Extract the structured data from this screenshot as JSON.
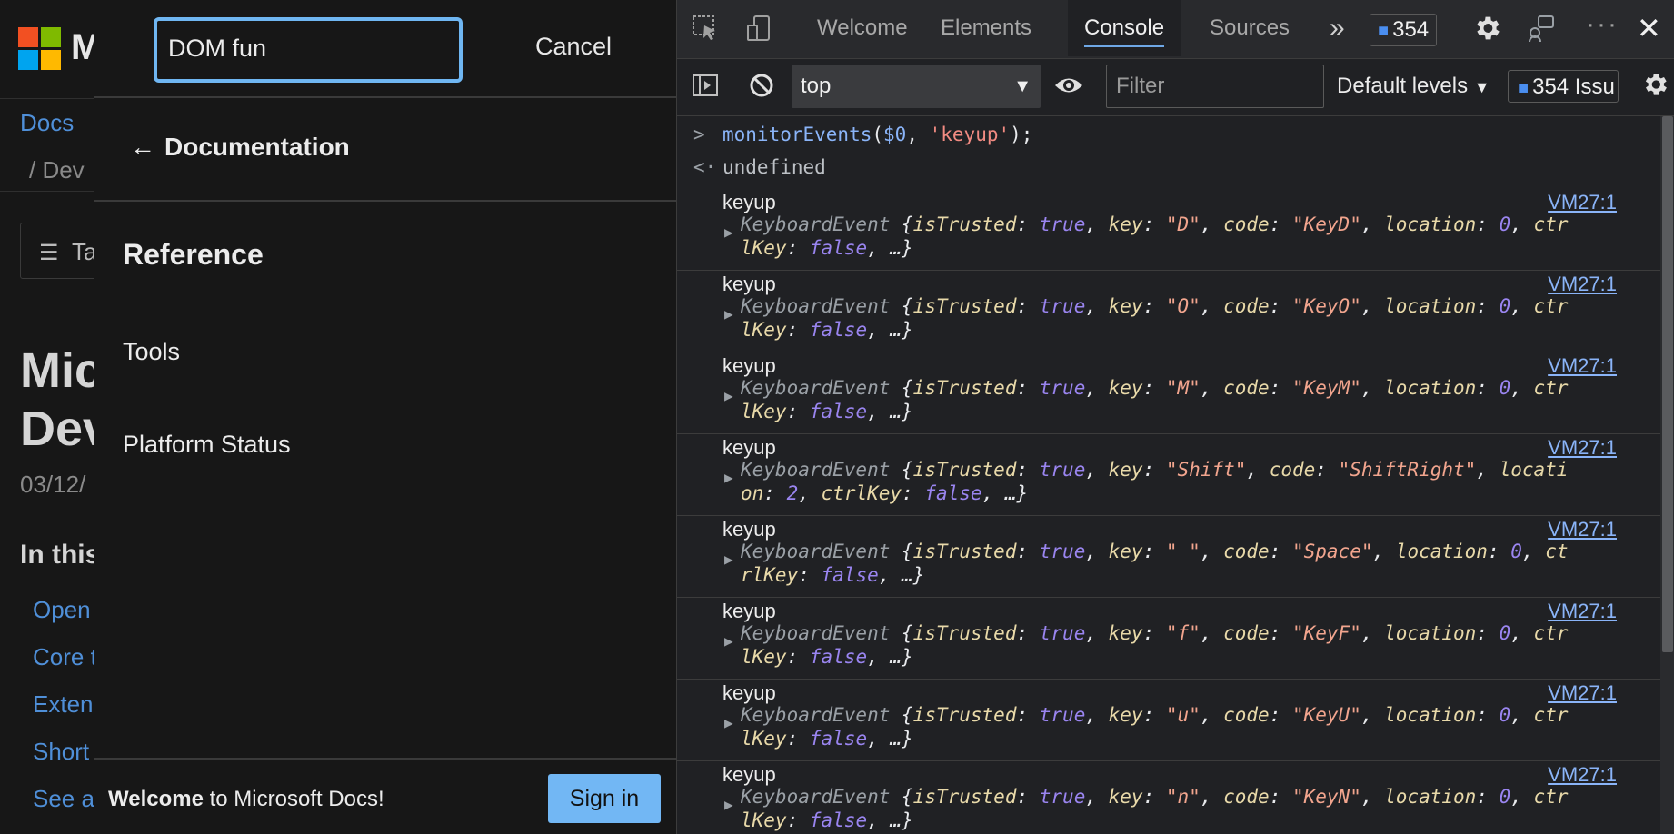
{
  "bg": {
    "logo_text": "M",
    "crumb": "Docs",
    "crumb2": "/  Dev",
    "toc_label": "Ta",
    "title_line1": "Mic",
    "title_line2": "Dev",
    "date": "03/12/",
    "in_this": "In this",
    "links": [
      "Open",
      "Core t",
      "Exten",
      "Short",
      "See a"
    ]
  },
  "overlay": {
    "search_value": "DOM fun",
    "cancel_label": "Cancel",
    "back_label": "Documentation",
    "section_heading": "Reference",
    "nav_items": [
      "Tools",
      "Platform Status"
    ],
    "welcome_bold": "Welcome",
    "welcome_rest": " to Microsoft Docs!",
    "signin_label": "Sign in"
  },
  "devtools": {
    "tabs": [
      "Welcome",
      "Elements",
      "Console",
      "Sources"
    ],
    "active_tab": "Console",
    "more_tabs": "»",
    "issues_badge": "354",
    "context": "top",
    "filter_placeholder": "Filter",
    "levels_label": "Default levels",
    "issues_label": "354 Issu",
    "icons": [
      "inspect-icon",
      "device-icon",
      "settings-icon",
      "feedback-icon",
      "more-icon",
      "close-icon",
      "sidebar-toggle-icon",
      "clear-console-icon",
      "eye-icon",
      "console-settings-icon"
    ]
  },
  "console": {
    "command_fn": "monitorEvents",
    "command_arg": "$0",
    "command_str": "'keyup'",
    "result": "undefined",
    "source": "VM27:1",
    "event_type": "keyup",
    "events": [
      {
        "key": "\"D\"",
        "code": "\"KeyD\"",
        "location": "0",
        "wrap": "ctr|lKey"
      },
      {
        "key": "\"O\"",
        "code": "\"KeyO\"",
        "location": "0",
        "wrap": "ctr|lKey"
      },
      {
        "key": "\"M\"",
        "code": "\"KeyM\"",
        "location": "0",
        "wrap": "ctr|lKey"
      },
      {
        "key": "\"Shift\"",
        "code": "\"ShiftRight\"",
        "location": "2",
        "wrap": "locati|on"
      },
      {
        "key": "\" \"",
        "code": "\"Space\"",
        "location": "0",
        "wrap": "ct|rlKey"
      },
      {
        "key": "\"f\"",
        "code": "\"KeyF\"",
        "location": "0",
        "wrap": "ctr|lKey"
      },
      {
        "key": "\"u\"",
        "code": "\"KeyU\"",
        "location": "0",
        "wrap": "ctr|lKey"
      },
      {
        "key": "\"n\"",
        "code": "\"KeyN\"",
        "location": "0",
        "wrap": "ctr|lKey"
      }
    ]
  }
}
